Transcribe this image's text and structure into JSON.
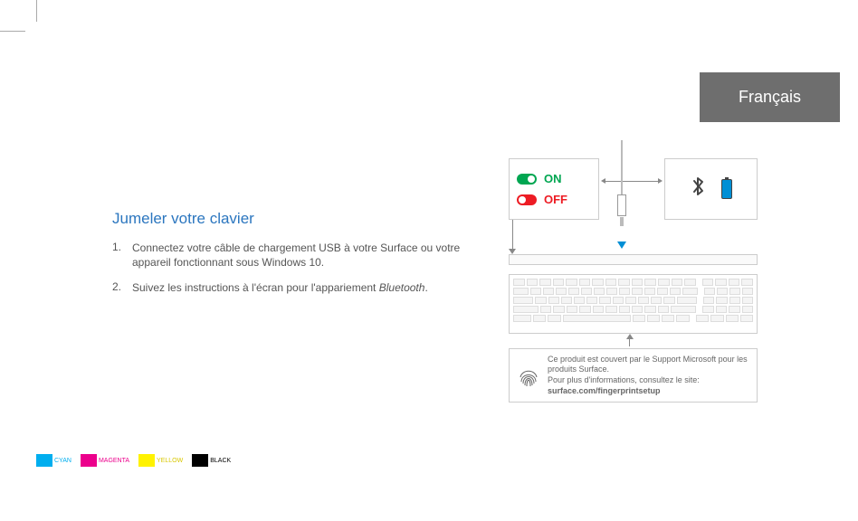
{
  "language_tab": "Français",
  "title": "Jumeler votre clavier",
  "steps": [
    {
      "num": "1.",
      "text": "Connectez votre câble de chargement USB à votre Surface ou votre appareil fonctionnant sous Windows 10."
    },
    {
      "num": "2.",
      "text_prefix": "Suivez les instructions à l'écran pour l'appariement ",
      "text_em": "Bluetooth",
      "text_suffix": "."
    }
  ],
  "switch": {
    "on": "ON",
    "off": "OFF"
  },
  "info": {
    "line1": "Ce produit est couvert par le Support Microsoft pour les produits Surface.",
    "line2": "Pour plus d'informations, consultez le site:",
    "url": "surface.com/fingerprintsetup"
  },
  "color_labels": {
    "cyan": "CYAN",
    "magenta": "MAGENTA",
    "yellow": "YELLOW",
    "black": "BLACK"
  }
}
